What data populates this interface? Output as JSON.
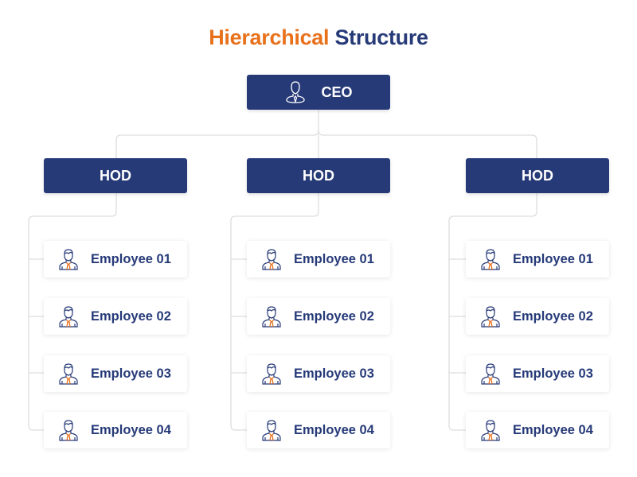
{
  "title": {
    "part1": "Hierarchical",
    "part2": "Structure"
  },
  "colors": {
    "accent": "#e8711c",
    "primary": "#263a78",
    "connector": "#dddddd"
  },
  "ceo": {
    "label": "CEO",
    "icon": "executive-user-icon"
  },
  "departments": [
    {
      "label": "HOD",
      "employees": [
        {
          "label": "Employee 01",
          "icon": "employee-icon"
        },
        {
          "label": "Employee 02",
          "icon": "employee-icon"
        },
        {
          "label": "Employee 03",
          "icon": "employee-icon"
        },
        {
          "label": "Employee 04",
          "icon": "employee-icon"
        }
      ]
    },
    {
      "label": "HOD",
      "employees": [
        {
          "label": "Employee 01",
          "icon": "employee-icon"
        },
        {
          "label": "Employee 02",
          "icon": "employee-icon"
        },
        {
          "label": "Employee 03",
          "icon": "employee-icon"
        },
        {
          "label": "Employee 04",
          "icon": "employee-icon"
        }
      ]
    },
    {
      "label": "HOD",
      "employees": [
        {
          "label": "Employee 01",
          "icon": "employee-icon"
        },
        {
          "label": "Employee 02",
          "icon": "employee-icon"
        },
        {
          "label": "Employee 03",
          "icon": "employee-icon"
        },
        {
          "label": "Employee 04",
          "icon": "employee-icon"
        }
      ]
    }
  ]
}
